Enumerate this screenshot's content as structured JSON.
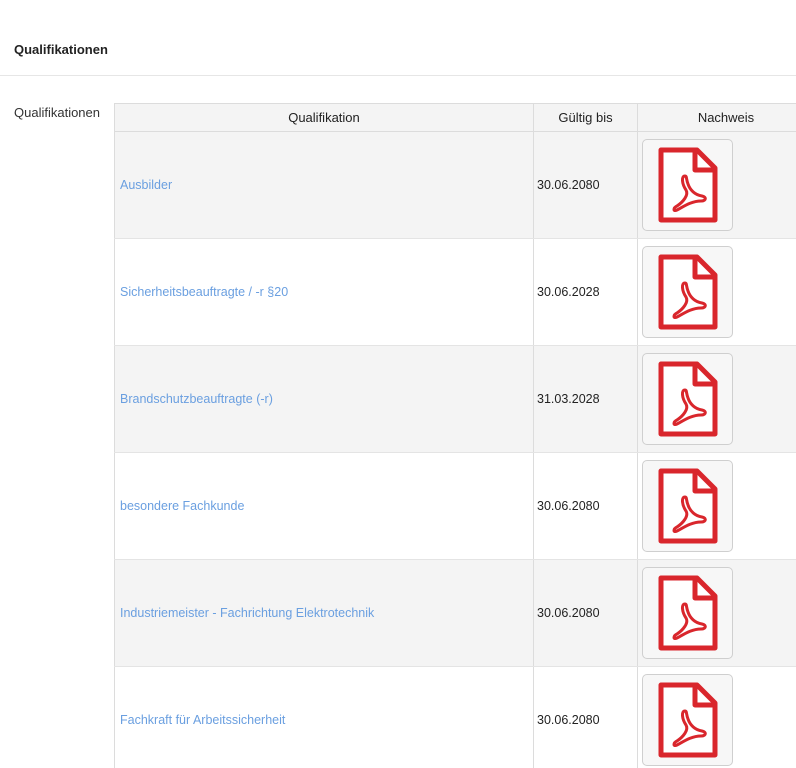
{
  "section": {
    "title": "Qualifikationen"
  },
  "field": {
    "label": "Qualifikationen"
  },
  "table": {
    "headers": [
      "Qualifikation",
      "Gültig bis",
      "Nachweis"
    ],
    "rows": [
      {
        "qualification": "Ausbilder",
        "valid_until": "30.06.2080",
        "proof_icon": "pdf-document-icon"
      },
      {
        "qualification": "Sicherheitsbeauftragte / -r §20",
        "valid_until": "30.06.2028",
        "proof_icon": "pdf-document-icon"
      },
      {
        "qualification": "Brandschutzbeauftragte (-r)",
        "valid_until": "31.03.2028",
        "proof_icon": "pdf-document-icon"
      },
      {
        "qualification": "besondere Fachkunde",
        "valid_until": "30.06.2080",
        "proof_icon": "pdf-document-icon"
      },
      {
        "qualification": "Industriemeister - Fachrichtung Elektrotechnik",
        "valid_until": "30.06.2080",
        "proof_icon": "pdf-document-icon"
      },
      {
        "qualification": "Fachkraft für Arbeitssicherheit",
        "valid_until": "30.06.2080",
        "proof_icon": "pdf-document-icon"
      }
    ]
  },
  "colors": {
    "link": "#6a9fe0",
    "pdf_red": "#d9262c",
    "row_alt": "#f4f4f4",
    "border": "#dcdcdc"
  }
}
